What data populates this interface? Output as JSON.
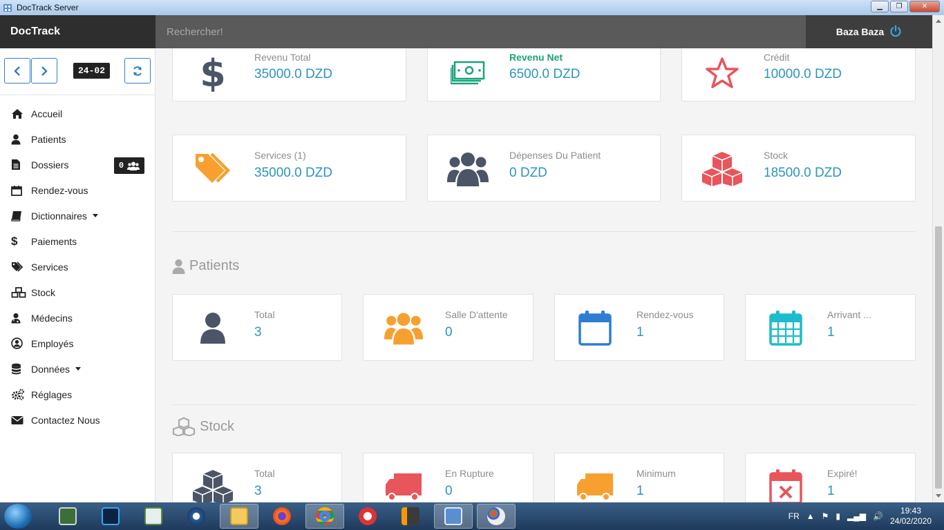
{
  "window": {
    "title": "DocTrack Server"
  },
  "header": {
    "brand": "DocTrack",
    "search_placeholder": "Rechercher!",
    "user_name": "Baza Baza"
  },
  "sidebar": {
    "date_badge": "24-02",
    "items": [
      {
        "label": "Accueil",
        "icon": "home-icon"
      },
      {
        "label": "Patients",
        "icon": "user-icon"
      },
      {
        "label": "Dossiers",
        "icon": "file-icon",
        "badge": "0"
      },
      {
        "label": "Rendez-vous",
        "icon": "calendar-icon"
      },
      {
        "label": "Dictionnaires",
        "icon": "book-icon",
        "dropdown": true
      },
      {
        "label": "Paiements",
        "icon": "dollar-icon"
      },
      {
        "label": "Services",
        "icon": "tags-icon"
      },
      {
        "label": "Stock",
        "icon": "cubes-icon"
      },
      {
        "label": "Médecins",
        "icon": "user-md-icon"
      },
      {
        "label": "Employés",
        "icon": "user-circle-icon"
      },
      {
        "label": "Données",
        "icon": "database-icon",
        "dropdown": true
      },
      {
        "label": "Réglages",
        "icon": "cogs-icon"
      },
      {
        "label": "Contactez Nous",
        "icon": "envelope-icon"
      }
    ]
  },
  "finance_cards": [
    {
      "label": "Revenu Total",
      "value": "35000.0 DZD",
      "icon": "dollar-icon"
    },
    {
      "label": "Revenu Net",
      "value": "6500.0 DZD",
      "icon": "money-icon"
    },
    {
      "label": "Crédit",
      "value": "10000.0 DZD",
      "icon": "star-icon"
    },
    {
      "label": "Services (1)",
      "value": "35000.0 DZD",
      "icon": "tags-icon"
    },
    {
      "label": "Dépenses Du Patient",
      "value": "0 DZD",
      "icon": "users-icon"
    },
    {
      "label": "Stock",
      "value": "18500.0 DZD",
      "icon": "cubes-icon"
    }
  ],
  "patients_section": {
    "title": "Patients",
    "cards": [
      {
        "label": "Total",
        "value": "3",
        "icon": "user-icon"
      },
      {
        "label": "Salle D'attente",
        "value": "0",
        "icon": "users-icon"
      },
      {
        "label": "Rendez-vous",
        "value": "1",
        "icon": "calendar-icon"
      },
      {
        "label": "Arrivant ...",
        "value": "1",
        "icon": "calendar-grid-icon"
      }
    ]
  },
  "stock_section": {
    "title": "Stock",
    "cards": [
      {
        "label": "Total",
        "value": "3",
        "icon": "cubes-icon"
      },
      {
        "label": "En Rupture",
        "value": "0",
        "icon": "truck-icon"
      },
      {
        "label": "Minimum",
        "value": "1",
        "icon": "truck-icon"
      },
      {
        "label": "Expiré!",
        "value": "1",
        "icon": "calendar-times-icon"
      }
    ]
  },
  "taskbar": {
    "language": "FR",
    "time": "19:43",
    "date": "24/02/2020"
  },
  "colors": {
    "accent": "#2b94bf",
    "green": "#1aa37a",
    "red": "#e8555a",
    "orange": "#f7a030",
    "gray_icon": "#4b5566",
    "blue": "#2d7dd2",
    "teal": "#1bbccc"
  }
}
